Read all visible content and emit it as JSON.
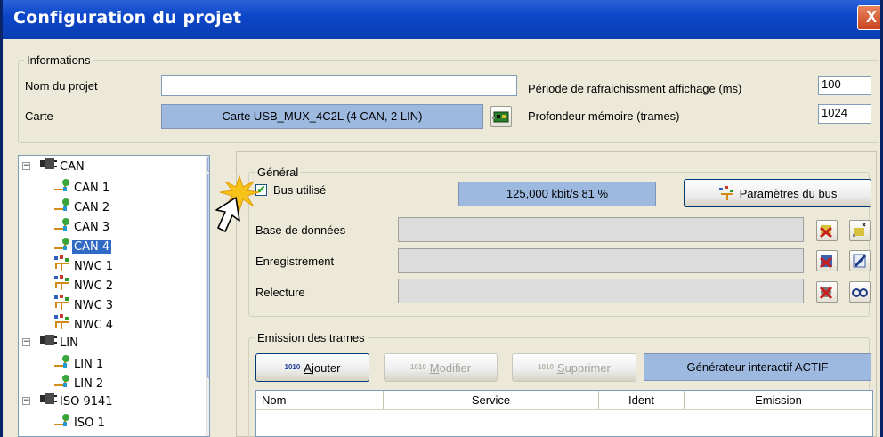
{
  "window": {
    "title": "Configuration du projet",
    "close_label": "X"
  },
  "informations": {
    "legend": "Informations",
    "project_name_label": "Nom du projet",
    "project_name_value": "",
    "card_label": "Carte",
    "card_value": "Carte USB_MUX_4C2L (4 CAN, 2 LIN)",
    "refresh_label": "Période de rafraichissment affichage (ms)",
    "refresh_value": "100",
    "memory_label": "Profondeur mémoire (trames)",
    "memory_value": "1024"
  },
  "tree": {
    "items": [
      {
        "label": "CAN",
        "level": 0,
        "expander": "−"
      },
      {
        "label": "CAN 1",
        "level": 1
      },
      {
        "label": "CAN 2",
        "level": 1
      },
      {
        "label": "CAN 3",
        "level": 1
      },
      {
        "label": "CAN 4",
        "level": 1,
        "selected": true
      },
      {
        "label": "NWC 1",
        "level": 1
      },
      {
        "label": "NWC 2",
        "level": 1
      },
      {
        "label": "NWC 3",
        "level": 1
      },
      {
        "label": "NWC 4",
        "level": 1
      },
      {
        "label": "LIN",
        "level": 0,
        "expander": "−"
      },
      {
        "label": "LIN 1",
        "level": 1
      },
      {
        "label": "LIN 2",
        "level": 1
      },
      {
        "label": "ISO 9141",
        "level": 0,
        "expander": "−"
      },
      {
        "label": "ISO 1",
        "level": 1
      }
    ]
  },
  "general": {
    "legend": "Général",
    "bus_used_label": "Bus utilisé",
    "bus_used_checked": true,
    "bus_rate": "125,000 kbit/s 81 %",
    "bus_params_button": "Paramètres du bus",
    "database_label": "Base de données",
    "recording_label": "Enregistrement",
    "replay_label": "Relecture"
  },
  "emission": {
    "legend": "Emission des trames",
    "add_button": "Ajouter",
    "add_button_underline": "A",
    "add_button_rest": "jouter",
    "modify_button": "Modifier",
    "modify_button_underline": "M",
    "modify_button_rest": "odifier",
    "delete_button": "Supprimer",
    "delete_button_underline": "S",
    "delete_button_rest": "upprimer",
    "generator_status": "Générateur interactif ACTIF",
    "columns": [
      "Nom",
      "Service",
      "Ident",
      "Emission"
    ],
    "icon_text": "1010"
  },
  "colors": {
    "title_bar": "#0c46c9",
    "selection": "#316ac5",
    "status_box": "#9db9e0"
  }
}
